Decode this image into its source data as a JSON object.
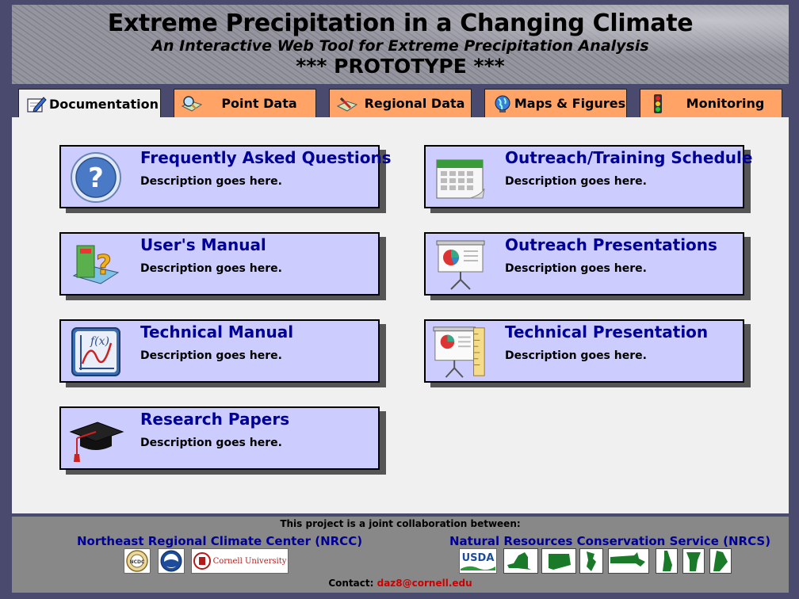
{
  "header": {
    "title": "Extreme Precipitation in a Changing Climate",
    "subtitle": "An Interactive Web Tool for Extreme Precipitation Analysis",
    "prototype": "*** PROTOTYPE ***"
  },
  "tabs": [
    {
      "label": "Documentation",
      "icon": "pencil-notepad-icon",
      "active": true
    },
    {
      "label": "Point Data",
      "icon": "magnifier-map-icon",
      "active": false
    },
    {
      "label": "Regional Data",
      "icon": "map-pencil-icon",
      "active": false
    },
    {
      "label": "Maps & Figures",
      "icon": "globe-icon",
      "active": false
    },
    {
      "label": "Monitoring",
      "icon": "traffic-light-icon",
      "active": false
    }
  ],
  "cards": [
    {
      "title": "Frequently Asked Questions",
      "desc": "Description goes here.",
      "icon": "question-icon"
    },
    {
      "title": "Outreach/Training Schedule",
      "desc": "Description goes here.",
      "icon": "calendar-icon"
    },
    {
      "title": "User's Manual",
      "desc": "Description goes here.",
      "icon": "help-book-icon"
    },
    {
      "title": "Outreach Presentations",
      "desc": "Description goes here.",
      "icon": "presentation-icon"
    },
    {
      "title": "Technical Manual",
      "desc": "Description goes here.",
      "icon": "function-graph-icon"
    },
    {
      "title": "Technical Presentation",
      "desc": "Description goes here.",
      "icon": "presentation-ruler-icon"
    },
    {
      "title": "Research Papers",
      "desc": "Description goes here.",
      "icon": "graduation-cap-icon"
    }
  ],
  "footer": {
    "collab": "This project is a joint collaboration between:",
    "left_partner": "Northeast Regional Climate Center (NRCC)",
    "right_partner": "Natural Resources Conservation Service (NRCS)",
    "contact_label": "Contact:",
    "contact_email": "daz8@cornell.edu",
    "logos": {
      "ncdc": "NCDC",
      "cornell": "Cornell University",
      "usda": "USDA"
    }
  },
  "colors": {
    "tab_bg": "#ffa366",
    "card_bg": "#ccccff",
    "title_blue": "#000099",
    "page_bg": "#4a4a6e"
  }
}
